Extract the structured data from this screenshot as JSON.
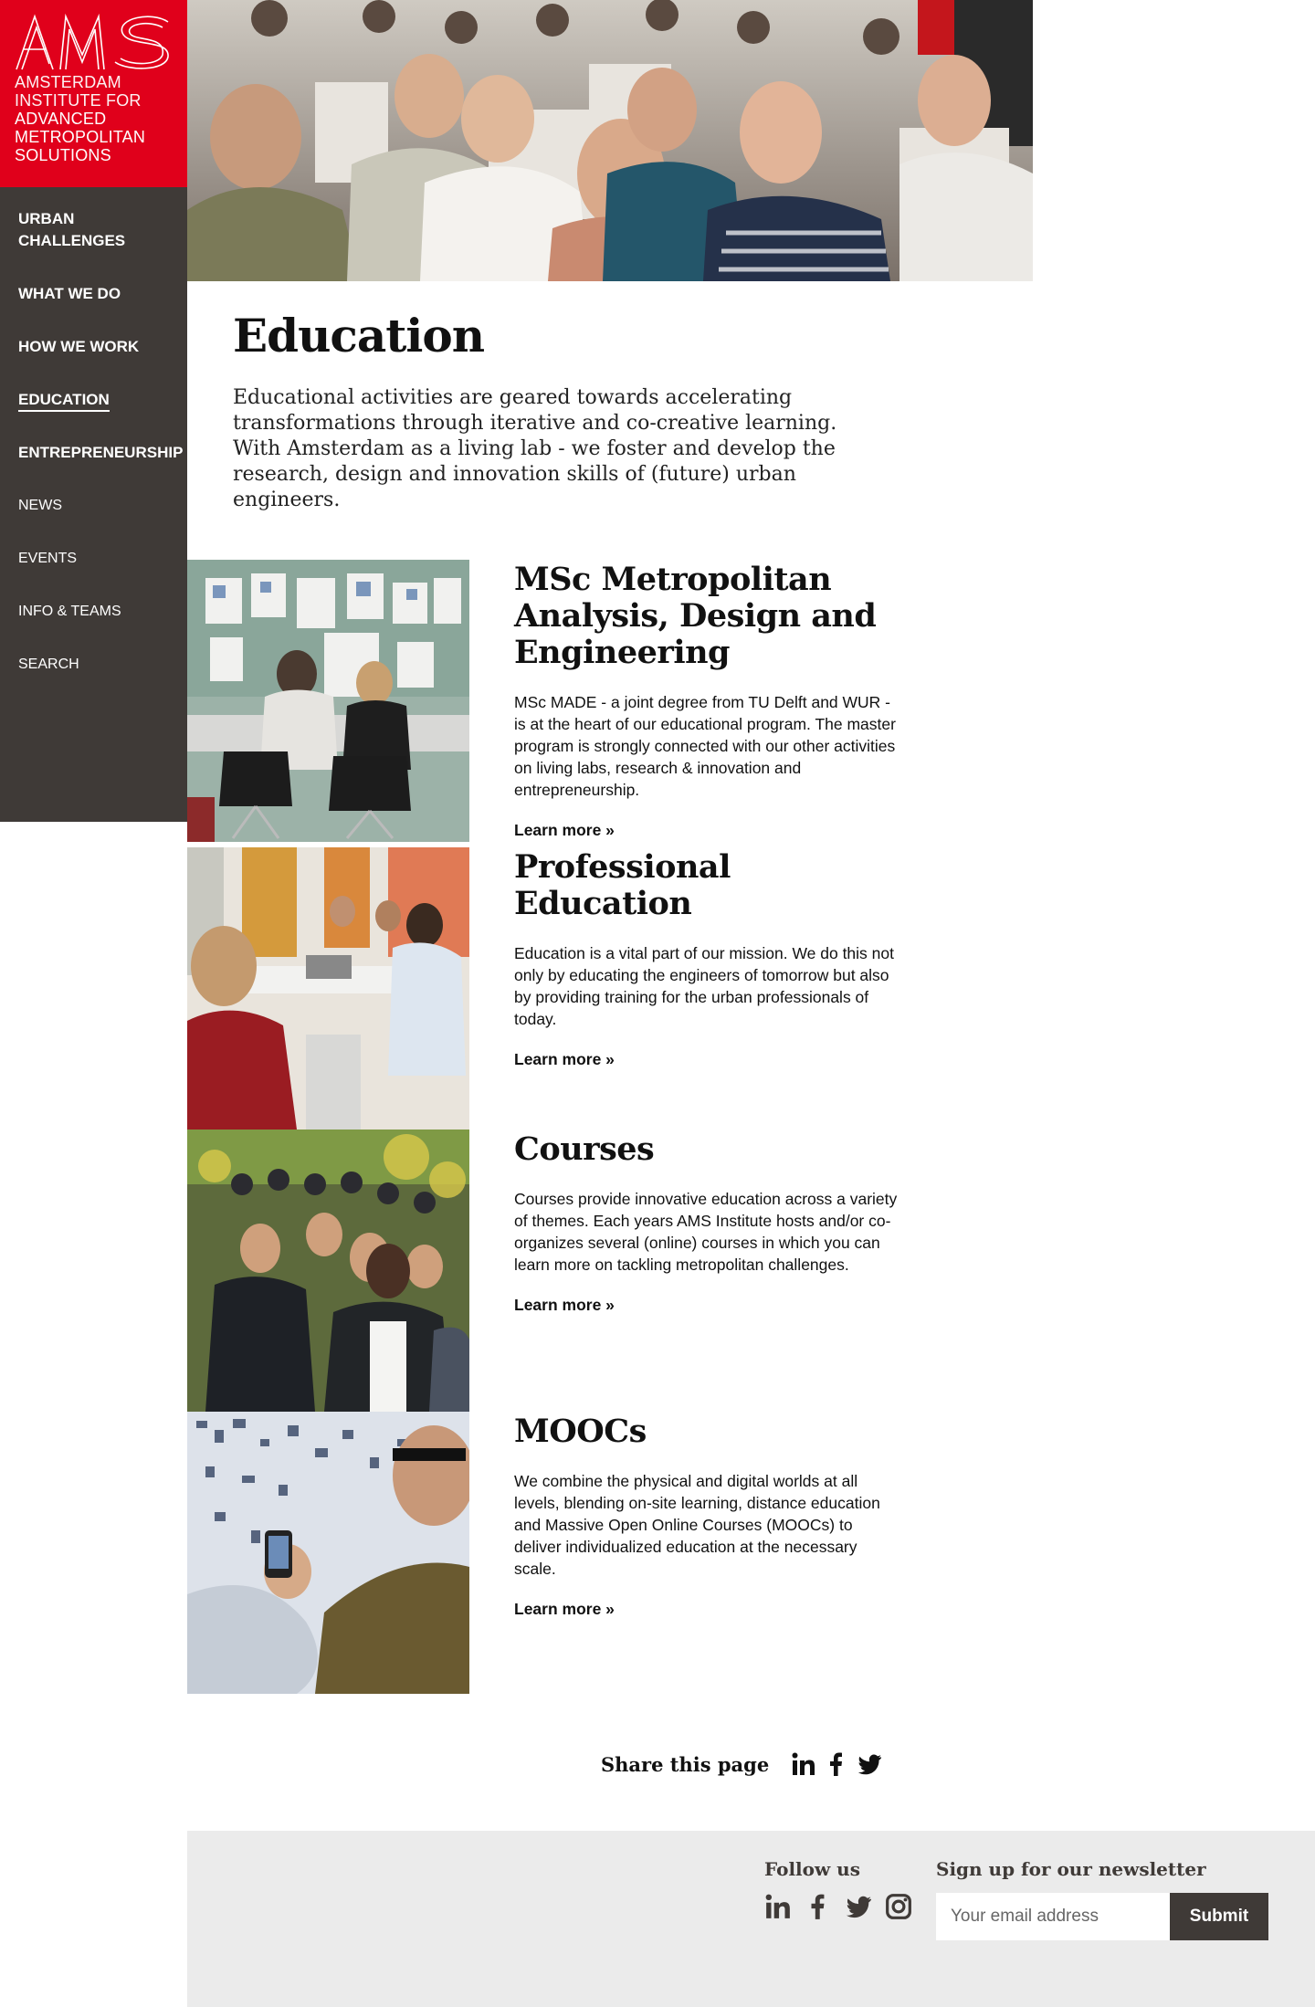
{
  "brand": {
    "logo_mark": "AMS",
    "name_lines": [
      "AMSTERDAM",
      "INSTITUTE FOR",
      "ADVANCED",
      "METROPOLITAN",
      "SOLUTIONS"
    ],
    "color": "#e0001b"
  },
  "sidebar": {
    "background": "#3f3a37",
    "items": [
      {
        "label": "URBAN CHALLENGES",
        "style": "main",
        "active": false
      },
      {
        "label": "WHAT WE DO",
        "style": "main",
        "active": false
      },
      {
        "label": "HOW WE WORK",
        "style": "main",
        "active": false
      },
      {
        "label": "EDUCATION",
        "style": "main",
        "active": true
      },
      {
        "label": "ENTREPRENEURSHIP",
        "style": "main",
        "active": false
      },
      {
        "label": "NEWS",
        "style": "sub",
        "active": false
      },
      {
        "label": "EVENTS",
        "style": "sub",
        "active": false
      },
      {
        "label": "INFO & TEAMS",
        "style": "sub",
        "active": false
      },
      {
        "label": "SEARCH",
        "style": "sub",
        "active": false
      }
    ]
  },
  "main": {
    "title": "Education",
    "intro": "Educational activities are geared towards accelerating transformations through iterative and co-creative learning. With Amsterdam as a living lab - we foster and develop the research, design and innovation skills of (future) urban engineers.",
    "programs": [
      {
        "title": "MSc Metropolitan Analysis, Design and Engineering",
        "description": "MSc MADE - a joint degree from TU Delft and WUR - is at the heart of our educational program. The master program is strongly connected with our other activities on living labs, research & innovation and entrepreneurship.",
        "link": "Learn more »"
      },
      {
        "title": "Professional Education",
        "description": "Education is a vital part of our mission. We do this not only by educating the engineers of tomorrow but also by providing training for the urban professionals of today.",
        "link": "Learn more »"
      },
      {
        "title": "Courses",
        "description": "Courses provide innovative education across a variety of themes. Each years AMS Institute hosts and/or co-organizes several (online) courses in which you can learn more on tackling metropolitan challenges.",
        "link": "Learn more »"
      },
      {
        "title": "MOOCs",
        "description": "We combine the physical and digital worlds at all levels, blending on-site learning, distance education and Massive Open Online Courses (MOOCs) to deliver individualized education at the necessary scale.",
        "link": "Learn more »"
      }
    ]
  },
  "share": {
    "label": "Share this page",
    "icons": [
      "linkedin-icon",
      "facebook-icon",
      "twitter-icon"
    ]
  },
  "footer": {
    "follow_label": "Follow us",
    "follow_icons": [
      "linkedin-icon",
      "facebook-icon",
      "twitter-icon",
      "instagram-icon"
    ],
    "newsletter_label": "Sign up for our newsletter",
    "email_placeholder": "Your email address",
    "submit_label": "Submit",
    "background": "#ebebeb"
  }
}
